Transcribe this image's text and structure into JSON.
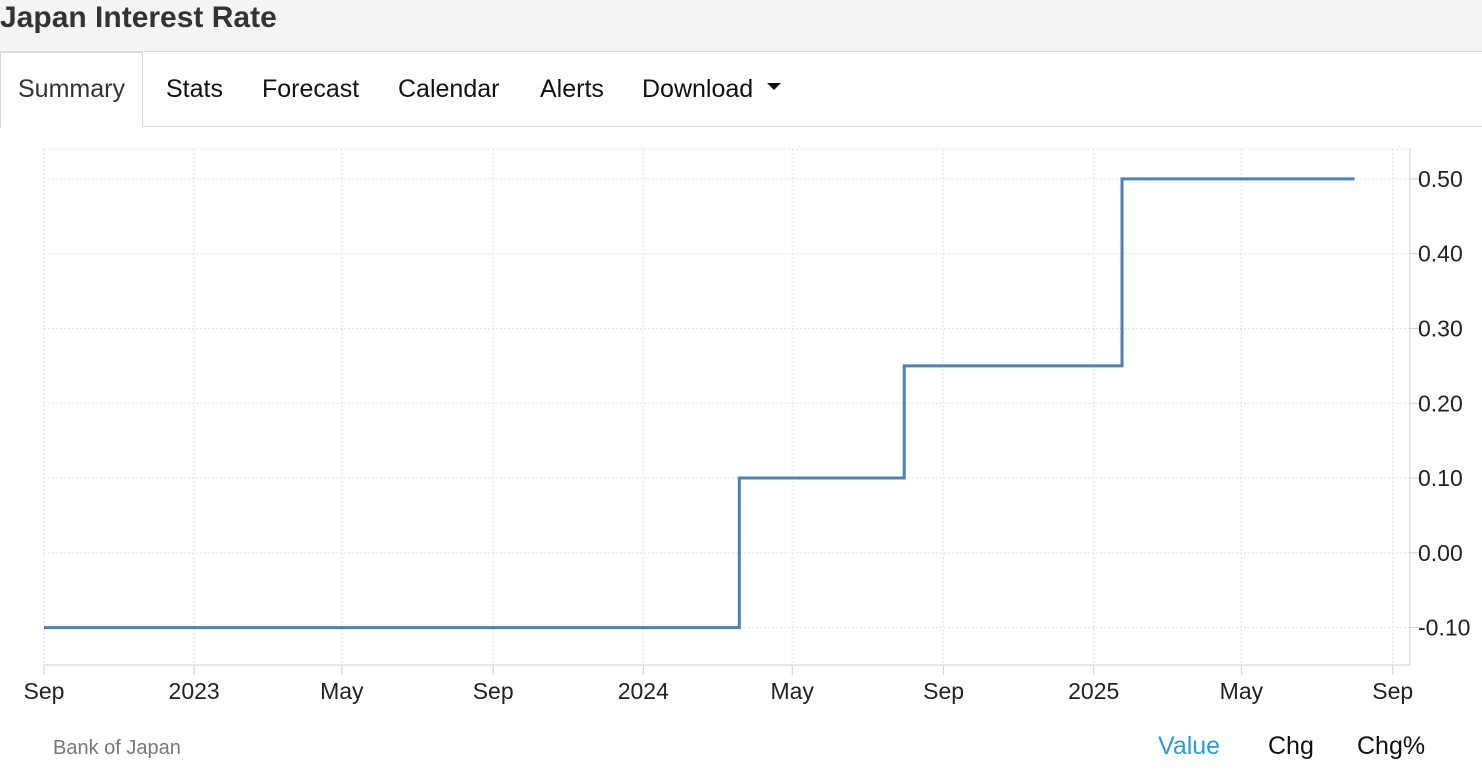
{
  "header": {
    "title": "Japan Interest Rate"
  },
  "tabs": [
    {
      "label": "Summary",
      "active": true
    },
    {
      "label": "Stats"
    },
    {
      "label": "Forecast"
    },
    {
      "label": "Calendar"
    },
    {
      "label": "Alerts"
    },
    {
      "label": "Download",
      "dropdown": true
    }
  ],
  "footer": {
    "source": "Bank of Japan",
    "views": [
      {
        "label": "Value",
        "active": true
      },
      {
        "label": "Chg"
      },
      {
        "label": "Chg%"
      }
    ]
  },
  "colors": {
    "line": "#4f81b5",
    "active_view": "#2f9ad8"
  },
  "chart_data": {
    "type": "line",
    "step": true,
    "title": "",
    "xlabel": "",
    "ylabel": "",
    "ylim": [
      -0.15,
      0.54
    ],
    "xlim": [
      "2022-09-01",
      "2025-09-15"
    ],
    "y_ticks": [
      -0.1,
      0.0,
      0.1,
      0.2,
      0.3,
      0.4,
      0.5
    ],
    "y_tick_labels": [
      "-0.10",
      "0.00",
      "0.10",
      "0.20",
      "0.30",
      "0.40",
      "0.50"
    ],
    "x_ticks": [
      "2022-09-01",
      "2023-01-01",
      "2023-05-01",
      "2023-09-01",
      "2024-01-01",
      "2024-05-01",
      "2024-09-01",
      "2025-01-01",
      "2025-05-01",
      "2025-09-01"
    ],
    "x_tick_labels": [
      "Sep",
      "2023",
      "May",
      "Sep",
      "2024",
      "May",
      "Sep",
      "2025",
      "May",
      "Sep"
    ],
    "grid": true,
    "y_axis_position": "right",
    "series": [
      {
        "points": [
          {
            "x": "2022-09-01",
            "y": -0.1
          },
          {
            "x": "2024-03-19",
            "y": 0.1
          },
          {
            "x": "2024-07-31",
            "y": 0.25
          },
          {
            "x": "2025-01-24",
            "y": 0.5
          },
          {
            "x": "2025-08-01",
            "y": 0.5
          }
        ]
      }
    ]
  }
}
